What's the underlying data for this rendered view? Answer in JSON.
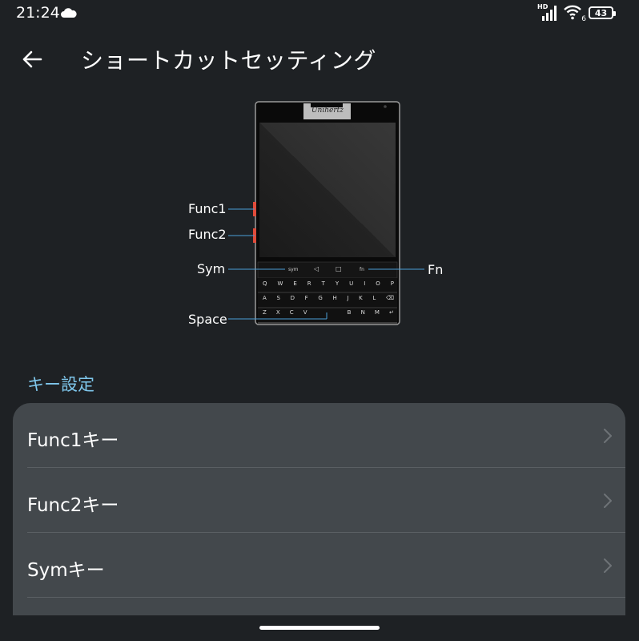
{
  "status_bar": {
    "time": "21:24",
    "network_label": "HD",
    "wifi_badge": "6",
    "battery_level": "43",
    "icons": [
      "cloud-icon",
      "signal-icon",
      "wifi-icon",
      "battery-icon"
    ]
  },
  "header": {
    "back_icon": "arrow-left-icon",
    "title": "ショートカットセッティング"
  },
  "diagram": {
    "brand": "Unihertz",
    "labels": {
      "func1": "Func1",
      "func2": "Func2",
      "sym": "Sym",
      "fn": "Fn",
      "space": "Space"
    },
    "keyboard": {
      "top_row": [
        "sym",
        "◁",
        "□",
        "fn"
      ],
      "row1": [
        "Q",
        "W",
        "E",
        "R",
        "T",
        "Y",
        "U",
        "I",
        "O",
        "P"
      ],
      "row2": [
        "A",
        "S",
        "D",
        "F",
        "G",
        "H",
        "J",
        "K",
        "L",
        "⌫"
      ],
      "row3": [
        "Z",
        "X",
        "C",
        "V",
        "",
        "B",
        "N",
        "M",
        "↵"
      ]
    }
  },
  "section": {
    "title": "キー設定"
  },
  "settings": {
    "items": [
      {
        "label": "Func1キー"
      },
      {
        "label": "Func2キー"
      },
      {
        "label": "Symキー"
      }
    ]
  },
  "colors": {
    "background": "#1e2124",
    "card": "#43484c",
    "accent": "#7fc7ec",
    "callout_line": "#4a9fd8",
    "side_key": "#e04b3a"
  }
}
